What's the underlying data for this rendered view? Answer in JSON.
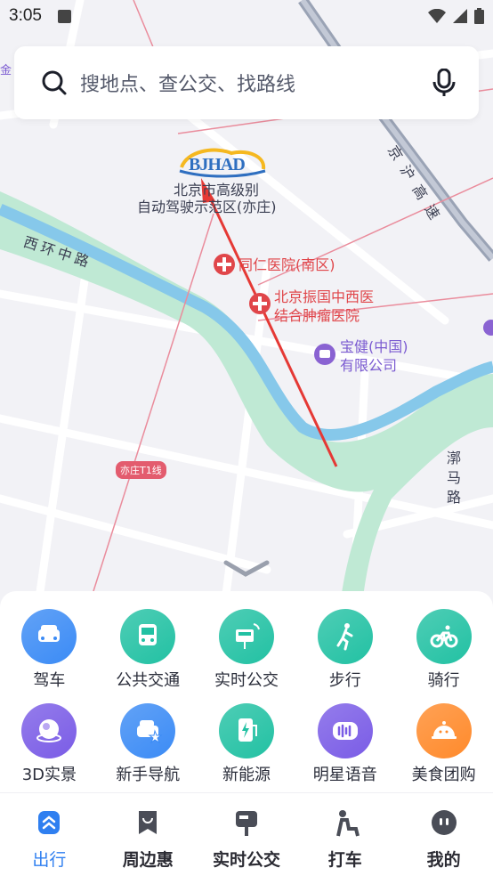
{
  "status_bar": {
    "time": "3:05"
  },
  "search": {
    "placeholder": "搜地点、查公交、找路线"
  },
  "map": {
    "logo_text": "BJHAD",
    "labels": {
      "zone_line1": "北京市高级别",
      "zone_line2": "自动驾驶示范区(亦庄)",
      "road_xihuan": "西环中路",
      "road_jinghu": "京沪高速",
      "road_mama": "漷马路",
      "poi_tongren": "同仁医院(南区)",
      "poi_zhenguo_1": "北京振国中西医",
      "poi_zhenguo_2": "结合肿瘤医院",
      "poi_baojian_1": "宝健(中国)",
      "poi_baojian_2": "有限公司",
      "metro_badge": "亦庄T1线",
      "edge_text": "金"
    }
  },
  "quick_actions": [
    {
      "label": "驾车",
      "icon": "car-icon",
      "color": "#3b8bf5"
    },
    {
      "label": "公共交通",
      "icon": "bus-icon",
      "color": "#22c1a3"
    },
    {
      "label": "实时公交",
      "icon": "realtime-bus-icon",
      "color": "#22c1a3"
    },
    {
      "label": "步行",
      "icon": "walk-icon",
      "color": "#22c1a3"
    },
    {
      "label": "骑行",
      "icon": "bike-icon",
      "color": "#22c1a3"
    },
    {
      "label": "3D实景",
      "icon": "globe-3d-icon",
      "color": "#7a5ce6"
    },
    {
      "label": "新手导航",
      "icon": "new-driver-icon",
      "color": "#3b8bf5"
    },
    {
      "label": "新能源",
      "icon": "charging-icon",
      "color": "#22c1a3"
    },
    {
      "label": "明星语音",
      "icon": "voice-icon",
      "color": "#7a5ce6"
    },
    {
      "label": "美食团购",
      "icon": "food-icon",
      "color": "#ff8a2b"
    }
  ],
  "tabs": [
    {
      "label": "出行",
      "icon": "travel-icon",
      "active": true
    },
    {
      "label": "周边惠",
      "icon": "coupon-icon",
      "active": false
    },
    {
      "label": "实时公交",
      "icon": "bus-stop-icon",
      "active": false
    },
    {
      "label": "打车",
      "icon": "taxi-icon",
      "active": false
    },
    {
      "label": "我的",
      "icon": "profile-icon",
      "active": false
    }
  ],
  "colors": {
    "accent": "#2f7ff0",
    "river": "#a8ddc7",
    "water": "#7fc4e8",
    "route": "#e53935"
  }
}
